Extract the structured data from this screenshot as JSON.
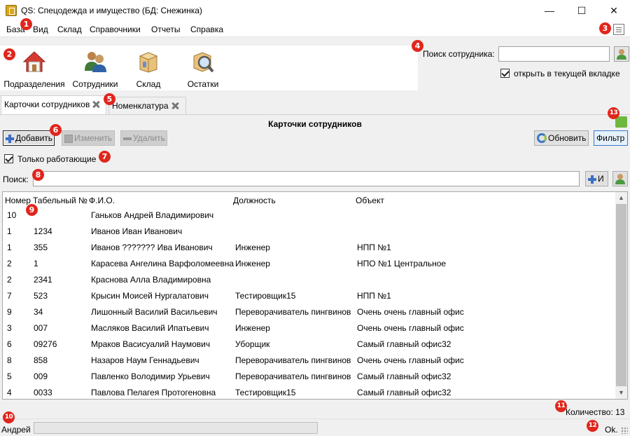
{
  "window": {
    "title": "QS: Спецодежда и имущество (БД: Снежинка)",
    "minimize_glyph": "—",
    "maximize_glyph": "☐",
    "close_glyph": "✕"
  },
  "menu": [
    "База",
    "Вид",
    "Склад",
    "Справочники",
    "Отчеты",
    "Справка"
  ],
  "toolbar": {
    "buttons": [
      {
        "label": "Подразделения",
        "icon": "house-icon"
      },
      {
        "label": "Сотрудники",
        "icon": "people-icon"
      },
      {
        "label": "Склад",
        "icon": "box-icon"
      },
      {
        "label": "Остатки",
        "icon": "magnifier-box-icon"
      }
    ]
  },
  "employee_search": {
    "label": "Поиск сотрудника:",
    "value": "",
    "open_in_tab_label": "открыть в текущей вкладке",
    "open_in_tab_checked": true
  },
  "tabs": [
    {
      "label": "Карточки сотрудников",
      "active": true
    },
    {
      "label": "Номенклатура",
      "active": false
    }
  ],
  "panel": {
    "title": "Карточки сотрудников",
    "add_label": "Добавить",
    "edit_label": "Изменить",
    "delete_label": "Удалить",
    "refresh_label": "Обновить",
    "filter_label": "Фильтр",
    "only_working_label": "Только работающие",
    "only_working_checked": true,
    "search_label": "Поиск:",
    "search_value": "",
    "add_and_label": "И"
  },
  "table": {
    "columns": [
      "Номер",
      "Табельный №",
      "Ф.И.О.",
      "Должность",
      "Объект"
    ],
    "rows": [
      [
        "10",
        "",
        "Ганьков Андрей Владимирович",
        "",
        ""
      ],
      [
        "1",
        "1234",
        "Иванов Иван Иванович",
        "",
        ""
      ],
      [
        "1",
        "355",
        "Иванов ??????? Ива Иванович",
        "Инженер",
        "НПП №1"
      ],
      [
        "2",
        "1",
        "Карасева Ангелина Варфоломеевна",
        "Инженер",
        "НПО №1 Центральное"
      ],
      [
        "2",
        "2341",
        "Краснова Алла Владимировна",
        "",
        ""
      ],
      [
        "7",
        "523",
        "Крысин Моисей  Нургалатович",
        "Тестировщик15",
        "НПП №1"
      ],
      [
        "9",
        "34",
        "Лишонный Василий Васильевич",
        "Переворачиватель пингвинов",
        "Очень очень главный офис"
      ],
      [
        "3",
        "007",
        "Масляков Василий Ипатьевич",
        "Инженер",
        "Очень очень главный офис"
      ],
      [
        "6",
        "09276",
        "Мраков Васисуалий Наумович",
        "Уборщик",
        "Самый главный офис32"
      ],
      [
        "8",
        "858",
        "Назаров Наум Геннадьевич",
        "Переворачиватель пингвинов",
        "Очень очень главный офис"
      ],
      [
        "5",
        "009",
        "Павленко Володимир Урьевич",
        "Переворачиватель пингвинов",
        "Самый главный офис32"
      ],
      [
        "4",
        "0033",
        "Павлова Пелагея  Протогеновна",
        "Тестировщик15",
        "Самый главный офис32"
      ]
    ]
  },
  "count_label": "Количество: 13",
  "status": {
    "user": "Андрей",
    "ok": "Ok."
  },
  "badges": [
    "1",
    "2",
    "3",
    "4",
    "5",
    "6",
    "7",
    "8",
    "9",
    "10",
    "11",
    "12",
    "13"
  ],
  "colors": {
    "badge": "#e0261d",
    "accent": "#3a78c8"
  }
}
